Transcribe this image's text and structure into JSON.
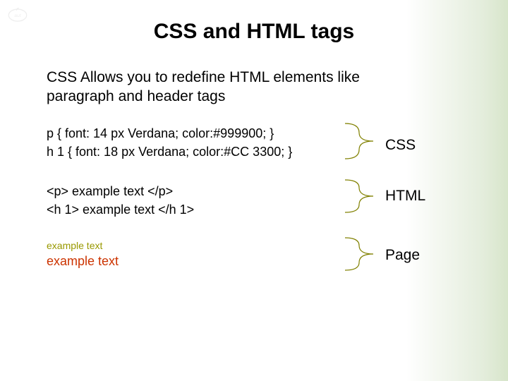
{
  "title": "CSS and HTML tags",
  "subtitle": "CSS Allows you to redefine HTML elements like paragraph and header tags",
  "css_block": {
    "line1": "p {  font: 14 px Verdana; color:#999900; }",
    "line2": "h 1 { font: 18 px Verdana; color:#CC 3300; }"
  },
  "html_block": {
    "line1": "<p> example text </p>",
    "line2": "<h 1> example text </h 1>"
  },
  "page_block": {
    "p_text": "example text",
    "h1_text": "example text"
  },
  "labels": {
    "css": "CSS",
    "html": "HTML",
    "page": "Page"
  }
}
